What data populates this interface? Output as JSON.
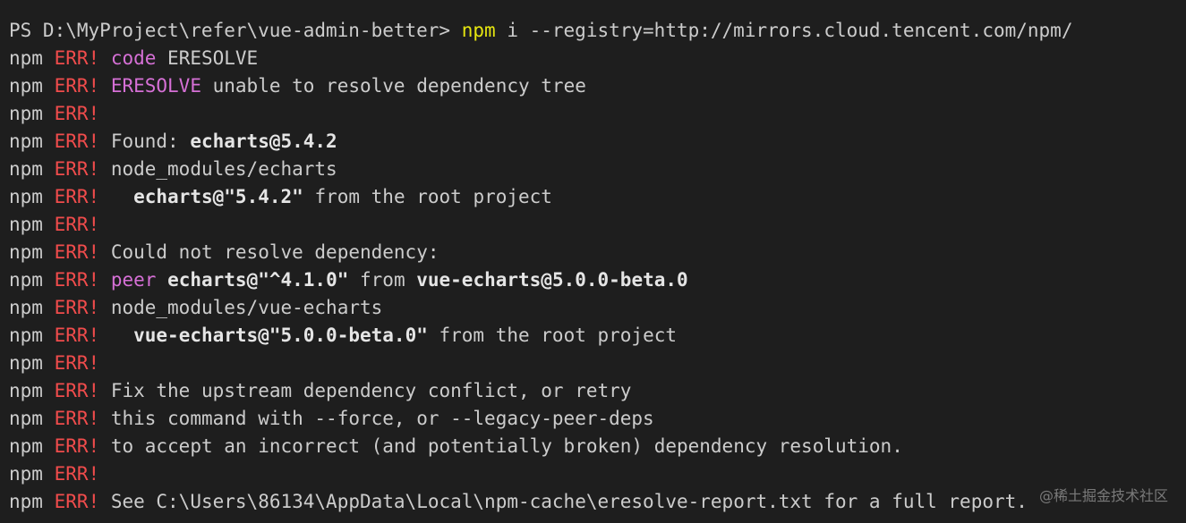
{
  "colors": {
    "background": "#1e1e1e",
    "text": "#cccccc",
    "err": "#f14c4c",
    "keyword": "#d670d6",
    "command": "#e5e510"
  },
  "prompt": {
    "path": "PS D:\\MyProject\\refer\\vue-admin-better> ",
    "command": "npm",
    "args": " i --registry=http://mirrors.cloud.tencent.com/npm/"
  },
  "prefix": "npm",
  "err_label": "ERR!",
  "lines": [
    [
      {
        "t": "code",
        "c": "kw"
      },
      {
        "t": " ERESOLVE"
      }
    ],
    [
      {
        "t": "ERESOLVE",
        "c": "kw"
      },
      {
        "t": " unable to resolve dependency tree"
      }
    ],
    [],
    [
      {
        "t": "Found: "
      },
      {
        "t": "echarts@5.4.2",
        "c": "b"
      }
    ],
    [
      {
        "t": "node_modules/echarts"
      }
    ],
    [
      {
        "t": "  "
      },
      {
        "t": "echarts",
        "c": "b"
      },
      {
        "t": "@\"5.4.2\"",
        "c": "b"
      },
      {
        "t": " from the root project"
      }
    ],
    [],
    [
      {
        "t": "Could not resolve dependency:"
      }
    ],
    [
      {
        "t": "peer",
        "c": "kw"
      },
      {
        "t": " "
      },
      {
        "t": "echarts",
        "c": "b"
      },
      {
        "t": "@\"^4.1.0\"",
        "c": "b"
      },
      {
        "t": " from "
      },
      {
        "t": "vue-echarts@5.0.0-beta.0",
        "c": "b"
      }
    ],
    [
      {
        "t": "node_modules/vue-echarts"
      }
    ],
    [
      {
        "t": "  "
      },
      {
        "t": "vue-echarts",
        "c": "b"
      },
      {
        "t": "@\"5.0.0-beta.0\"",
        "c": "b"
      },
      {
        "t": " from the root project"
      }
    ],
    [],
    [
      {
        "t": "Fix the upstream dependency conflict, or retry"
      }
    ],
    [
      {
        "t": "this command with --force, or --legacy-peer-deps"
      }
    ],
    [
      {
        "t": "to accept an incorrect (and potentially broken) dependency resolution."
      }
    ],
    [],
    [
      {
        "t": "See C:\\Users\\86134\\AppData\\Local\\npm-cache\\eresolve-report.txt for a full report."
      }
    ]
  ],
  "watermark": "@稀土掘金技术社区"
}
